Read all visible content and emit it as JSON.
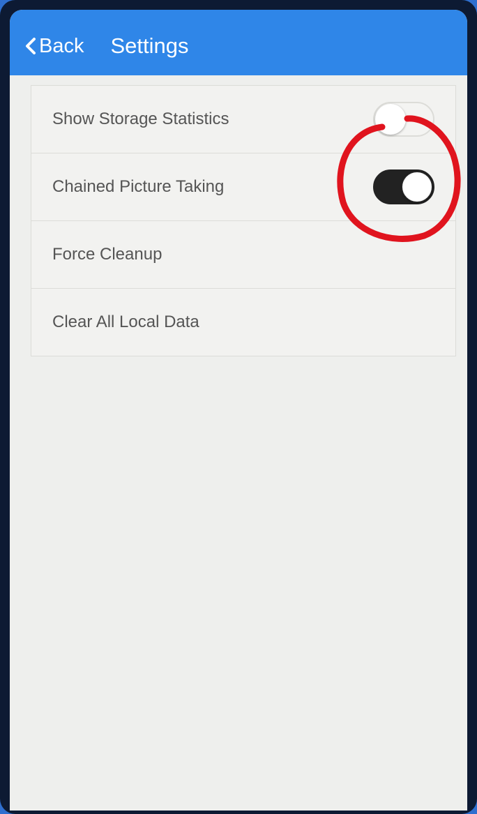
{
  "header": {
    "back_label": "Back",
    "title": "Settings"
  },
  "settings": {
    "items": [
      {
        "label": "Show Storage Statistics",
        "toggle": "off"
      },
      {
        "label": "Chained Picture Taking",
        "toggle": "on"
      },
      {
        "label": "Force Cleanup"
      },
      {
        "label": "Clear All Local Data"
      }
    ]
  },
  "colors": {
    "navbar": "#2f86e8",
    "background": "#eeefed",
    "annotation": "#e0141e"
  },
  "icons": {
    "back": "chevron-left-icon"
  }
}
